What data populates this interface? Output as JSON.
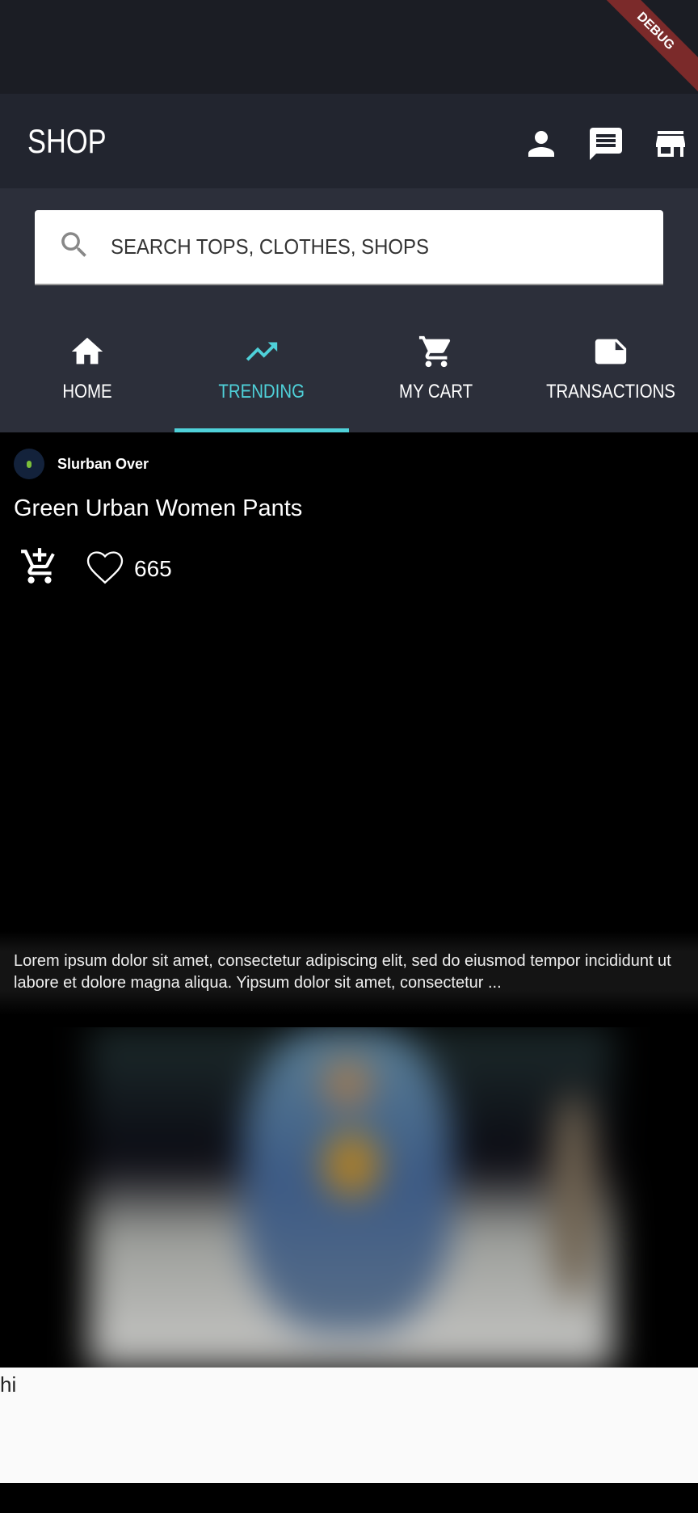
{
  "appbar": {
    "title": "SHOP",
    "actions": [
      "person-icon",
      "chat-icon",
      "store-icon"
    ]
  },
  "search": {
    "placeholder": "SEARCH TOPS, CLOTHES, SHOPS"
  },
  "tabs": [
    {
      "label": "HOME",
      "icon": "home-icon"
    },
    {
      "label": "TRENDING",
      "icon": "trending-up-icon",
      "active": true
    },
    {
      "label": "MY CART",
      "icon": "cart-icon"
    },
    {
      "label": "TRANSACTIONS",
      "icon": "note-icon"
    }
  ],
  "colors": {
    "accent": "#4fd1d9",
    "appbar": "#22252f",
    "tabbar": "#2c2f3a"
  },
  "post": {
    "shop_name": "Slurban Over",
    "product_name": "Green Urban Women Pants",
    "likes": "665",
    "description": "Lorem ipsum dolor sit amet, consectetur adipiscing elit, sed do eiusmod tempor incididunt ut labore et dolore magna aliqua. Yipsum dolor sit amet, consectetur ..."
  },
  "footer": {
    "text": "hi"
  },
  "debug_banner": "DEBUG"
}
